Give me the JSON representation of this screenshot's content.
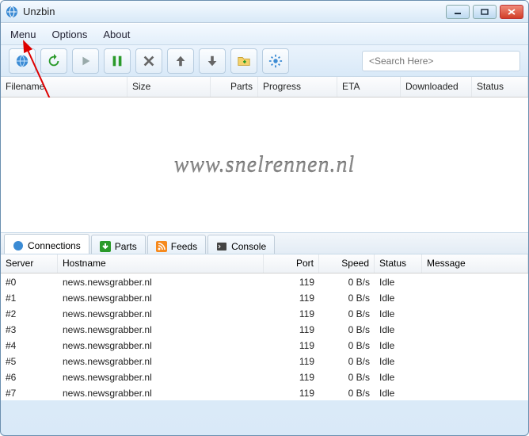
{
  "app": {
    "title": "Unzbin"
  },
  "menu": {
    "items": [
      "Menu",
      "Options",
      "About"
    ]
  },
  "toolbar": {
    "buttons": [
      "globe",
      "refresh",
      "play",
      "pause",
      "cancel",
      "up",
      "down",
      "folder",
      "settings"
    ],
    "search_placeholder": "<Search Here>"
  },
  "downloads": {
    "columns": [
      "Filename",
      "Size",
      "Parts",
      "Progress",
      "ETA",
      "Downloaded",
      "Status"
    ],
    "rows": []
  },
  "watermark": "www.snelrennen.nl",
  "tabs": [
    {
      "icon": "globe",
      "label": "Connections",
      "active": true
    },
    {
      "icon": "down-green",
      "label": "Parts"
    },
    {
      "icon": "rss",
      "label": "Feeds"
    },
    {
      "icon": "console",
      "label": "Console"
    }
  ],
  "connections": {
    "columns": [
      "Server",
      "Hostname",
      "Port",
      "Speed",
      "Status",
      "Message"
    ],
    "rows": [
      {
        "server": "#0",
        "hostname": "news.newsgrabber.nl",
        "port": "119",
        "speed": "0 B/s",
        "status": "Idle",
        "message": ""
      },
      {
        "server": "#1",
        "hostname": "news.newsgrabber.nl",
        "port": "119",
        "speed": "0 B/s",
        "status": "Idle",
        "message": ""
      },
      {
        "server": "#2",
        "hostname": "news.newsgrabber.nl",
        "port": "119",
        "speed": "0 B/s",
        "status": "Idle",
        "message": ""
      },
      {
        "server": "#3",
        "hostname": "news.newsgrabber.nl",
        "port": "119",
        "speed": "0 B/s",
        "status": "Idle",
        "message": ""
      },
      {
        "server": "#4",
        "hostname": "news.newsgrabber.nl",
        "port": "119",
        "speed": "0 B/s",
        "status": "Idle",
        "message": ""
      },
      {
        "server": "#5",
        "hostname": "news.newsgrabber.nl",
        "port": "119",
        "speed": "0 B/s",
        "status": "Idle",
        "message": ""
      },
      {
        "server": "#6",
        "hostname": "news.newsgrabber.nl",
        "port": "119",
        "speed": "0 B/s",
        "status": "Idle",
        "message": ""
      },
      {
        "server": "#7",
        "hostname": "news.newsgrabber.nl",
        "port": "119",
        "speed": "0 B/s",
        "status": "Idle",
        "message": ""
      }
    ]
  }
}
